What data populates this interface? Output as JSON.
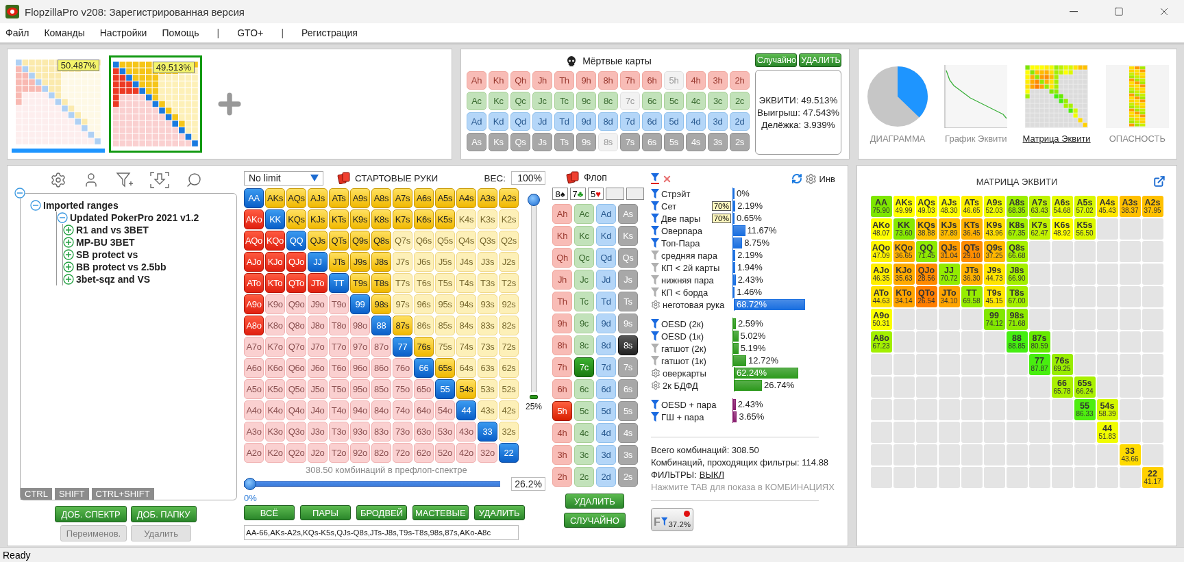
{
  "window": {
    "title": "FlopzillaPro v208: Зарегистрированная версия"
  },
  "menu": [
    {
      "kind": "item",
      "label": "Файл"
    },
    {
      "kind": "item",
      "label": "Команды"
    },
    {
      "kind": "item",
      "label": "Настройки"
    },
    {
      "kind": "item",
      "label": "Помощь"
    },
    {
      "kind": "separator",
      "label": "|"
    },
    {
      "kind": "item",
      "label": "GTO+"
    },
    {
      "kind": "separator",
      "label": "|"
    },
    {
      "kind": "item",
      "label": "Регистрация"
    }
  ],
  "ranges_bar": {
    "ranges": [
      {
        "percent": "50.487%",
        "selected": false
      },
      {
        "percent": "49.513%",
        "selected": true
      }
    ]
  },
  "dead_cards": {
    "title": "Мёртвые карты",
    "buttons": [
      "Случайно",
      "УДАЛИТЬ"
    ],
    "rows": [
      [
        {
          "label": "Ah",
          "disabled": false
        },
        {
          "label": "Kh",
          "disabled": false
        },
        {
          "label": "Qh",
          "disabled": false
        },
        {
          "label": "Jh",
          "disabled": false
        },
        {
          "label": "Th",
          "disabled": false
        },
        {
          "label": "9h",
          "disabled": false
        },
        {
          "label": "8h",
          "disabled": false
        },
        {
          "label": "7h",
          "disabled": false
        },
        {
          "label": "6h",
          "disabled": false
        },
        {
          "label": "5h",
          "disabled": true
        },
        {
          "label": "4h",
          "disabled": false
        },
        {
          "label": "3h",
          "disabled": false
        },
        {
          "label": "2h",
          "disabled": false
        }
      ],
      [
        {
          "label": "Ac",
          "disabled": false
        },
        {
          "label": "Kc",
          "disabled": false
        },
        {
          "label": "Qc",
          "disabled": false
        },
        {
          "label": "Jc",
          "disabled": false
        },
        {
          "label": "Tc",
          "disabled": false
        },
        {
          "label": "9c",
          "disabled": false
        },
        {
          "label": "8c",
          "disabled": false
        },
        {
          "label": "7c",
          "disabled": true
        },
        {
          "label": "6c",
          "disabled": false
        },
        {
          "label": "5c",
          "disabled": false
        },
        {
          "label": "4c",
          "disabled": false
        },
        {
          "label": "3c",
          "disabled": false
        },
        {
          "label": "2c",
          "disabled": false
        }
      ],
      [
        {
          "label": "Ad",
          "disabled": false
        },
        {
          "label": "Kd",
          "disabled": false
        },
        {
          "label": "Qd",
          "disabled": false
        },
        {
          "label": "Jd",
          "disabled": false
        },
        {
          "label": "Td",
          "disabled": false
        },
        {
          "label": "9d",
          "disabled": false
        },
        {
          "label": "8d",
          "disabled": false
        },
        {
          "label": "7d",
          "disabled": false
        },
        {
          "label": "6d",
          "disabled": false
        },
        {
          "label": "5d",
          "disabled": false
        },
        {
          "label": "4d",
          "disabled": false
        },
        {
          "label": "3d",
          "disabled": false
        },
        {
          "label": "2d",
          "disabled": false
        }
      ],
      [
        {
          "label": "As",
          "disabled": false
        },
        {
          "label": "Ks",
          "disabled": false
        },
        {
          "label": "Qs",
          "disabled": false
        },
        {
          "label": "Js",
          "disabled": false
        },
        {
          "label": "Ts",
          "disabled": false
        },
        {
          "label": "9s",
          "disabled": false
        },
        {
          "label": "8s",
          "disabled": true
        },
        {
          "label": "7s",
          "disabled": false
        },
        {
          "label": "6s",
          "disabled": false
        },
        {
          "label": "5s",
          "disabled": false
        },
        {
          "label": "4s",
          "disabled": false
        },
        {
          "label": "3s",
          "disabled": false
        },
        {
          "label": "2s",
          "disabled": false
        }
      ]
    ]
  },
  "equity": {
    "lines": [
      "ЭКВИТИ: 49.513%",
      "Выигрыш: 47.543%",
      "Делёжка: 3.939%"
    ]
  },
  "views": [
    {
      "label": "ДИАГРАММА",
      "kind": "pie",
      "selected": false
    },
    {
      "label": "График Эквити",
      "kind": "line",
      "selected": false
    },
    {
      "label": "Матрица Эквити",
      "kind": "matrix",
      "selected": true
    },
    {
      "label": "ОПАСНОСТЬ",
      "kind": "danger",
      "selected": false
    }
  ],
  "tree": {
    "expanded": true,
    "children": [
      {
        "label": "Imported ranges",
        "expanded": true,
        "children": [
          {
            "label": "Updated PokerPro 2021 v1.2",
            "expanded": true,
            "children": [
              {
                "label": "R1 and vs 3BET",
                "expanded": false
              },
              {
                "label": "MP-BU 3BET",
                "expanded": false
              },
              {
                "label": "SB protect vs",
                "expanded": false
              },
              {
                "label": "BB protect vs 2.5bb",
                "expanded": false
              },
              {
                "label": "3bet-sqz and VS",
                "expanded": false
              }
            ]
          }
        ]
      }
    ]
  },
  "modifier_tabs": [
    "CTRL",
    "SHIFT",
    "CTRL+SHIFT"
  ],
  "tree_buttons": [
    {
      "label": "ДОБ. СПЕКТР",
      "disabled": false
    },
    {
      "label": "ДОБ. ПАПКУ",
      "disabled": false
    },
    {
      "label": "Переименов.",
      "disabled": true
    },
    {
      "label": "Удалить",
      "disabled": true
    }
  ],
  "range": {
    "game": "No limit",
    "title": "СТАРТОВЫЕ РУКИ",
    "weight_label": "ВЕС:",
    "weight": "100%",
    "weight_slider": {
      "level": 1
    },
    "threshold": "25%",
    "rows": [
      {
        "cells": [
          {
            "label": "AA",
            "selected": true
          },
          {
            "label": "AKs",
            "selected": true
          },
          {
            "label": "AQs",
            "selected": true
          },
          {
            "label": "AJs",
            "selected": true
          },
          {
            "label": "ATs",
            "selected": true
          },
          {
            "label": "A9s",
            "selected": true
          },
          {
            "label": "A8s",
            "selected": true
          },
          {
            "label": "A7s",
            "selected": true
          },
          {
            "label": "A6s",
            "selected": true
          },
          {
            "label": "A5s",
            "selected": true
          },
          {
            "label": "A4s",
            "selected": true
          },
          {
            "label": "A3s",
            "selected": true
          },
          {
            "label": "A2s",
            "selected": true
          }
        ]
      },
      {
        "cells": [
          {
            "label": "AKo",
            "selected": true
          },
          {
            "label": "KK",
            "selected": true
          },
          {
            "label": "KQs",
            "selected": true
          },
          {
            "label": "KJs",
            "selected": true
          },
          {
            "label": "KTs",
            "selected": true
          },
          {
            "label": "K9s",
            "selected": true
          },
          {
            "label": "K8s",
            "selected": true
          },
          {
            "label": "K7s",
            "selected": true
          },
          {
            "label": "K6s",
            "selected": true
          },
          {
            "label": "K5s",
            "selected": true
          },
          {
            "label": "K4s",
            "selected": false
          },
          {
            "label": "K3s",
            "selected": false
          },
          {
            "label": "K2s",
            "selected": false
          }
        ]
      },
      {
        "cells": [
          {
            "label": "AQo",
            "selected": true
          },
          {
            "label": "KQo",
            "selected": true
          },
          {
            "label": "QQ",
            "selected": true
          },
          {
            "label": "QJs",
            "selected": true
          },
          {
            "label": "QTs",
            "selected": true
          },
          {
            "label": "Q9s",
            "selected": true
          },
          {
            "label": "Q8s",
            "selected": true
          },
          {
            "label": "Q7s",
            "selected": false
          },
          {
            "label": "Q6s",
            "selected": false
          },
          {
            "label": "Q5s",
            "selected": false
          },
          {
            "label": "Q4s",
            "selected": false
          },
          {
            "label": "Q3s",
            "selected": false
          },
          {
            "label": "Q2s",
            "selected": false
          }
        ]
      },
      {
        "cells": [
          {
            "label": "AJo",
            "selected": true
          },
          {
            "label": "KJo",
            "selected": true
          },
          {
            "label": "QJo",
            "selected": true
          },
          {
            "label": "JJ",
            "selected": true
          },
          {
            "label": "JTs",
            "selected": true
          },
          {
            "label": "J9s",
            "selected": true
          },
          {
            "label": "J8s",
            "selected": true
          },
          {
            "label": "J7s",
            "selected": false
          },
          {
            "label": "J6s",
            "selected": false
          },
          {
            "label": "J5s",
            "selected": false
          },
          {
            "label": "J4s",
            "selected": false
          },
          {
            "label": "J3s",
            "selected": false
          },
          {
            "label": "J2s",
            "selected": false
          }
        ]
      },
      {
        "cells": [
          {
            "label": "ATo",
            "selected": true
          },
          {
            "label": "KTo",
            "selected": true
          },
          {
            "label": "QTo",
            "selected": true
          },
          {
            "label": "JTo",
            "selected": true
          },
          {
            "label": "TT",
            "selected": true
          },
          {
            "label": "T9s",
            "selected": true
          },
          {
            "label": "T8s",
            "selected": true
          },
          {
            "label": "T7s",
            "selected": false
          },
          {
            "label": "T6s",
            "selected": false
          },
          {
            "label": "T5s",
            "selected": false
          },
          {
            "label": "T4s",
            "selected": false
          },
          {
            "label": "T3s",
            "selected": false
          },
          {
            "label": "T2s",
            "selected": false
          }
        ]
      },
      {
        "cells": [
          {
            "label": "A9o",
            "selected": true
          },
          {
            "label": "K9o",
            "selected": false
          },
          {
            "label": "Q9o",
            "selected": false
          },
          {
            "label": "J9o",
            "selected": false
          },
          {
            "label": "T9o",
            "selected": false
          },
          {
            "label": "99",
            "selected": true
          },
          {
            "label": "98s",
            "selected": true
          },
          {
            "label": "97s",
            "selected": false
          },
          {
            "label": "96s",
            "selected": false
          },
          {
            "label": "95s",
            "selected": false
          },
          {
            "label": "94s",
            "selected": false
          },
          {
            "label": "93s",
            "selected": false
          },
          {
            "label": "92s",
            "selected": false
          }
        ]
      },
      {
        "cells": [
          {
            "label": "A8o",
            "selected": true
          },
          {
            "label": "K8o",
            "selected": false
          },
          {
            "label": "Q8o",
            "selected": false
          },
          {
            "label": "J8o",
            "selected": false
          },
          {
            "label": "T8o",
            "selected": false
          },
          {
            "label": "98o",
            "selected": false
          },
          {
            "label": "88",
            "selected": true
          },
          {
            "label": "87s",
            "selected": true
          },
          {
            "label": "86s",
            "selected": false
          },
          {
            "label": "85s",
            "selected": false
          },
          {
            "label": "84s",
            "selected": false
          },
          {
            "label": "83s",
            "selected": false
          },
          {
            "label": "82s",
            "selected": false
          }
        ]
      },
      {
        "cells": [
          {
            "label": "A7o",
            "selected": false
          },
          {
            "label": "K7o",
            "selected": false
          },
          {
            "label": "Q7o",
            "selected": false
          },
          {
            "label": "J7o",
            "selected": false
          },
          {
            "label": "T7o",
            "selected": false
          },
          {
            "label": "97o",
            "selected": false
          },
          {
            "label": "87o",
            "selected": false
          },
          {
            "label": "77",
            "selected": true
          },
          {
            "label": "76s",
            "selected": true
          },
          {
            "label": "75s",
            "selected": false
          },
          {
            "label": "74s",
            "selected": false
          },
          {
            "label": "73s",
            "selected": false
          },
          {
            "label": "72s",
            "selected": false
          }
        ]
      },
      {
        "cells": [
          {
            "label": "A6o",
            "selected": false
          },
          {
            "label": "K6o",
            "selected": false
          },
          {
            "label": "Q6o",
            "selected": false
          },
          {
            "label": "J6o",
            "selected": false
          },
          {
            "label": "T6o",
            "selected": false
          },
          {
            "label": "96o",
            "selected": false
          },
          {
            "label": "86o",
            "selected": false
          },
          {
            "label": "76o",
            "selected": false
          },
          {
            "label": "66",
            "selected": true
          },
          {
            "label": "65s",
            "selected": true
          },
          {
            "label": "64s",
            "selected": false
          },
          {
            "label": "63s",
            "selected": false
          },
          {
            "label": "62s",
            "selected": false
          }
        ]
      },
      {
        "cells": [
          {
            "label": "A5o",
            "selected": false
          },
          {
            "label": "K5o",
            "selected": false
          },
          {
            "label": "Q5o",
            "selected": false
          },
          {
            "label": "J5o",
            "selected": false
          },
          {
            "label": "T5o",
            "selected": false
          },
          {
            "label": "95o",
            "selected": false
          },
          {
            "label": "85o",
            "selected": false
          },
          {
            "label": "75o",
            "selected": false
          },
          {
            "label": "65o",
            "selected": false
          },
          {
            "label": "55",
            "selected": true
          },
          {
            "label": "54s",
            "selected": true
          },
          {
            "label": "53s",
            "selected": false
          },
          {
            "label": "52s",
            "selected": false
          }
        ]
      },
      {
        "cells": [
          {
            "label": "A4o",
            "selected": false
          },
          {
            "label": "K4o",
            "selected": false
          },
          {
            "label": "Q4o",
            "selected": false
          },
          {
            "label": "J4o",
            "selected": false
          },
          {
            "label": "T4o",
            "selected": false
          },
          {
            "label": "94o",
            "selected": false
          },
          {
            "label": "84o",
            "selected": false
          },
          {
            "label": "74o",
            "selected": false
          },
          {
            "label": "64o",
            "selected": false
          },
          {
            "label": "54o",
            "selected": false
          },
          {
            "label": "44",
            "selected": true
          },
          {
            "label": "43s",
            "selected": false
          },
          {
            "label": "42s",
            "selected": false
          }
        ]
      },
      {
        "cells": [
          {
            "label": "A3o",
            "selected": false
          },
          {
            "label": "K3o",
            "selected": false
          },
          {
            "label": "Q3o",
            "selected": false
          },
          {
            "label": "J3o",
            "selected": false
          },
          {
            "label": "T3o",
            "selected": false
          },
          {
            "label": "93o",
            "selected": false
          },
          {
            "label": "83o",
            "selected": false
          },
          {
            "label": "73o",
            "selected": false
          },
          {
            "label": "63o",
            "selected": false
          },
          {
            "label": "53o",
            "selected": false
          },
          {
            "label": "43o",
            "selected": false
          },
          {
            "label": "33",
            "selected": true
          },
          {
            "label": "32s",
            "selected": false
          }
        ]
      },
      {
        "cells": [
          {
            "label": "A2o",
            "selected": false
          },
          {
            "label": "K2o",
            "selected": false
          },
          {
            "label": "Q2o",
            "selected": false
          },
          {
            "label": "J2o",
            "selected": false
          },
          {
            "label": "T2o",
            "selected": false
          },
          {
            "label": "92o",
            "selected": false
          },
          {
            "label": "82o",
            "selected": false
          },
          {
            "label": "72o",
            "selected": false
          },
          {
            "label": "62o",
            "selected": false
          },
          {
            "label": "52o",
            "selected": false
          },
          {
            "label": "42o",
            "selected": false
          },
          {
            "label": "32o",
            "selected": false
          },
          {
            "label": "22",
            "selected": true
          }
        ]
      }
    ],
    "combos_caption": "308.50 комбинаций в префлоп-спектре",
    "percent_slider": {
      "level": 0
    },
    "percent_min": "0%",
    "percent": "26.2%",
    "buttons": [
      "ВСЁ",
      "ПАРЫ",
      "БРОДВЕЙ",
      "МАСТЕВЫЕ",
      "УДАЛИТЬ"
    ],
    "text": "AA-66,AKs-A2s,KQs-K5s,QJs-Q8s,JTs-J8s,T9s-T8s,98s,87s,AKo-A8c"
  },
  "flop": {
    "title": "Флоп",
    "slots": [
      {
        "kind": "card",
        "rank": "8",
        "suit": "♠",
        "color": "#111111"
      },
      {
        "kind": "card",
        "rank": "7",
        "suit": "♣",
        "color": "#1f9a1f"
      },
      {
        "kind": "card",
        "rank": "5",
        "suit": "♥",
        "color": "#e01010"
      },
      {
        "kind": "empty"
      },
      {
        "kind": "empty"
      }
    ],
    "rows": [
      [
        {
          "label": "Ah",
          "selected": false
        },
        {
          "label": "Ac",
          "selected": false
        },
        {
          "label": "Ad",
          "selected": false
        },
        {
          "label": "As",
          "selected": false
        }
      ],
      [
        {
          "label": "Kh",
          "selected": false
        },
        {
          "label": "Kc",
          "selected": false
        },
        {
          "label": "Kd",
          "selected": false
        },
        {
          "label": "Ks",
          "selected": false
        }
      ],
      [
        {
          "label": "Qh",
          "selected": false
        },
        {
          "label": "Qc",
          "selected": false
        },
        {
          "label": "Qd",
          "selected": false
        },
        {
          "label": "Qs",
          "selected": false
        }
      ],
      [
        {
          "label": "Jh",
          "selected": false
        },
        {
          "label": "Jc",
          "selected": false
        },
        {
          "label": "Jd",
          "selected": false
        },
        {
          "label": "Js",
          "selected": false
        }
      ],
      [
        {
          "label": "Th",
          "selected": false
        },
        {
          "label": "Tc",
          "selected": false
        },
        {
          "label": "Td",
          "selected": false
        },
        {
          "label": "Ts",
          "selected": false
        }
      ],
      [
        {
          "label": "9h",
          "selected": false
        },
        {
          "label": "9c",
          "selected": false
        },
        {
          "label": "9d",
          "selected": false
        },
        {
          "label": "9s",
          "selected": false
        }
      ],
      [
        {
          "label": "8h",
          "selected": false
        },
        {
          "label": "8c",
          "selected": false
        },
        {
          "label": "8d",
          "selected": false
        },
        {
          "label": "8s",
          "selected": true
        }
      ],
      [
        {
          "label": "7h",
          "selected": false
        },
        {
          "label": "7c",
          "selected": true
        },
        {
          "label": "7d",
          "selected": false
        },
        {
          "label": "7s",
          "selected": false
        }
      ],
      [
        {
          "label": "6h",
          "selected": false
        },
        {
          "label": "6c",
          "selected": false
        },
        {
          "label": "6d",
          "selected": false
        },
        {
          "label": "6s",
          "selected": false
        }
      ],
      [
        {
          "label": "5h",
          "selected": true
        },
        {
          "label": "5c",
          "selected": false
        },
        {
          "label": "5d",
          "selected": false
        },
        {
          "label": "5s",
          "selected": false
        }
      ],
      [
        {
          "label": "4h",
          "selected": false
        },
        {
          "label": "4c",
          "selected": false
        },
        {
          "label": "4d",
          "selected": false
        },
        {
          "label": "4s",
          "selected": false
        }
      ],
      [
        {
          "label": "3h",
          "selected": false
        },
        {
          "label": "3c",
          "selected": false
        },
        {
          "label": "3d",
          "selected": false
        },
        {
          "label": "3s",
          "selected": false
        }
      ],
      [
        {
          "label": "2h",
          "selected": false
        },
        {
          "label": "2c",
          "selected": false
        },
        {
          "label": "2d",
          "selected": false
        },
        {
          "label": "2s",
          "selected": false
        }
      ]
    ],
    "buttons": [
      "УДАЛИТЬ",
      "СЛУЧАЙНО"
    ]
  },
  "stats": {
    "invert_label": "Инв",
    "groups": [
      {
        "color": "#1a6fe0",
        "items": [
          {
            "kind": "filter-on",
            "label": "Стрэйт",
            "value": "0%",
            "level": 0
          },
          {
            "kind": "filter-on",
            "label": "Сет",
            "badge": "70%",
            "value": "2.19%",
            "level": 0.0219
          },
          {
            "kind": "filter-on",
            "label": "Две пары",
            "badge": "70%",
            "value": "0.65%",
            "level": 0.0065
          },
          {
            "kind": "filter-on",
            "label": "Оверпара",
            "value": "11.67%",
            "level": 0.1167
          },
          {
            "kind": "filter-on",
            "label": "Топ-Пара",
            "value": "8.75%",
            "level": 0.0875
          },
          {
            "kind": "filter-off",
            "label": "средняя пара",
            "value": "2.19%",
            "level": 0.0219
          },
          {
            "kind": "filter-off",
            "label": "КП < 2й карты",
            "value": "1.94%",
            "level": 0.0194
          },
          {
            "kind": "filter-off",
            "label": "нижняя пара",
            "value": "2.43%",
            "level": 0.0243
          },
          {
            "kind": "filter-off",
            "label": "КП < борда",
            "value": "1.46%",
            "level": 0.0146
          },
          {
            "kind": "gear",
            "label": "неготовая рука",
            "value": "68.72%",
            "level": 0.6872
          }
        ]
      },
      {
        "color": "#2e9a1e",
        "items": [
          {
            "kind": "filter-on",
            "label": "OESD (2к)",
            "value": "2.59%",
            "level": 0.0259
          },
          {
            "kind": "filter-on",
            "label": "OESD (1к)",
            "value": "5.02%",
            "level": 0.0502
          },
          {
            "kind": "filter-off",
            "label": "гатшот (2к)",
            "value": "5.19%",
            "level": 0.0519
          },
          {
            "kind": "filter-off",
            "label": "гатшот (1к)",
            "value": "12.72%",
            "level": 0.1272
          },
          {
            "kind": "gear",
            "label": "оверкарты",
            "value": "62.24%",
            "level": 0.6224
          },
          {
            "kind": "gear",
            "label": "2к БДФД",
            "value": "26.74%",
            "level": 0.2674
          }
        ]
      },
      {
        "color": "#8a2070",
        "items": [
          {
            "kind": "filter-on",
            "label": "OESD + пара",
            "value": "2.43%",
            "level": 0.0243
          },
          {
            "kind": "filter-on",
            "label": "ГШ + пара",
            "value": "3.65%",
            "level": 0.0365
          }
        ]
      }
    ],
    "totals": [
      "Всего комбинаций: 308.50",
      "Комбинаций, проходящих фильтры: 114.88"
    ],
    "filters_label": "ФИЛЬТРЫ:",
    "filters_state": "ВЫКЛ",
    "hint": "Нажмите TAB для показа в КОМБИНАЦИЯХ",
    "filter_button": {
      "letter": "F",
      "value": "37.2%"
    }
  },
  "equity_matrix": {
    "title": "МАТРИЦА ЭКВИТИ",
    "rows": [
      [
        {
          "label": "AA",
          "value": "75.90",
          "color": "#7ee600"
        },
        {
          "label": "AKs",
          "value": "49.99",
          "color": "#ffff00"
        },
        {
          "label": "AQs",
          "value": "49.03",
          "color": "#ffff00"
        },
        {
          "label": "AJs",
          "value": "48.30",
          "color": "#ffff00"
        },
        {
          "label": "ATs",
          "value": "46.65",
          "color": "#fff000"
        },
        {
          "label": "A9s",
          "value": "52.03",
          "color": "#eefc00"
        },
        {
          "label": "A8s",
          "value": "68.35",
          "color": "#9cee00"
        },
        {
          "label": "A7s",
          "value": "63.43",
          "color": "#bdf200"
        },
        {
          "label": "A6s",
          "value": "54.68",
          "color": "#e4fa00"
        },
        {
          "label": "A5s",
          "value": "57.02",
          "color": "#d8f800"
        },
        {
          "label": "A4s",
          "value": "45.43",
          "color": "#ffe600"
        },
        {
          "label": "A3s",
          "value": "38.37",
          "color": "#ffbf00"
        },
        {
          "label": "A2s",
          "value": "37.95",
          "color": "#ffc000"
        }
      ],
      [
        {
          "label": "AKo",
          "value": "48.07",
          "color": "#ffff00"
        },
        {
          "label": "KK",
          "value": "73.60",
          "color": "#86e800"
        },
        {
          "label": "KQs",
          "value": "38.88",
          "color": "#ffc200"
        },
        {
          "label": "KJs",
          "value": "37.89",
          "color": "#ffbc00"
        },
        {
          "label": "KTs",
          "value": "36.45",
          "color": "#ffb000"
        },
        {
          "label": "K9s",
          "value": "43.96",
          "color": "#ffdd00"
        },
        {
          "label": "K8s",
          "value": "67.35",
          "color": "#a2ef00"
        },
        {
          "label": "K7s",
          "value": "62.47",
          "color": "#c2f300"
        },
        {
          "label": "K6s",
          "value": "48.92",
          "color": "#ffff00"
        },
        {
          "label": "K5s",
          "value": "56.50",
          "color": "#dcf800"
        },
        null,
        null,
        null
      ],
      [
        {
          "label": "AQo",
          "value": "47.09",
          "color": "#fff500"
        },
        {
          "label": "KQo",
          "value": "36.65",
          "color": "#ffb000"
        },
        {
          "label": "QQ",
          "value": "71.45",
          "color": "#8eea00"
        },
        {
          "label": "QJs",
          "value": "31.04",
          "color": "#ff9c00"
        },
        {
          "label": "QTs",
          "value": "29.10",
          "color": "#ff8c00"
        },
        {
          "label": "Q9s",
          "value": "37.25",
          "color": "#ffb800"
        },
        {
          "label": "Q8s",
          "value": "66.68",
          "color": "#a6ef00"
        },
        null,
        null,
        null,
        null,
        null,
        null
      ],
      [
        {
          "label": "AJo",
          "value": "46.35",
          "color": "#ffee00"
        },
        {
          "label": "KJo",
          "value": "35.63",
          "color": "#ffaa00"
        },
        {
          "label": "QJo",
          "value": "28.56",
          "color": "#ff8a00"
        },
        {
          "label": "JJ",
          "value": "70.72",
          "color": "#92eb00"
        },
        {
          "label": "JTs",
          "value": "36.30",
          "color": "#ffb000"
        },
        {
          "label": "J9s",
          "value": "44.73",
          "color": "#ffe400"
        },
        {
          "label": "J8s",
          "value": "66.90",
          "color": "#a4ef00"
        },
        null,
        null,
        null,
        null,
        null,
        null
      ],
      [
        {
          "label": "ATo",
          "value": "44.63",
          "color": "#ffe200"
        },
        {
          "label": "KTo",
          "value": "34.14",
          "color": "#ffa400"
        },
        {
          "label": "QTo",
          "value": "26.54",
          "color": "#ff7e00"
        },
        {
          "label": "JTo",
          "value": "34.10",
          "color": "#ffa400"
        },
        {
          "label": "TT",
          "value": "69.58",
          "color": "#96ec00"
        },
        {
          "label": "T9s",
          "value": "45.15",
          "color": "#ffe600"
        },
        {
          "label": "T8s",
          "value": "67.00",
          "color": "#a4ef00"
        },
        null,
        null,
        null,
        null,
        null,
        null
      ],
      [
        {
          "label": "A9o",
          "value": "50.31",
          "color": "#fafe00"
        },
        null,
        null,
        null,
        null,
        {
          "label": "99",
          "value": "74.12",
          "color": "#82e700"
        },
        {
          "label": "98s",
          "value": "71.68",
          "color": "#8eea00"
        },
        null,
        null,
        null,
        null,
        null,
        null
      ],
      [
        {
          "label": "A8o",
          "value": "67.23",
          "color": "#a2ef00"
        },
        null,
        null,
        null,
        null,
        null,
        {
          "label": "88",
          "value": "88.85",
          "color": "#44ee10"
        },
        {
          "label": "87s",
          "value": "80.59",
          "color": "#66ea00"
        },
        null,
        null,
        null,
        null,
        null
      ],
      [
        null,
        null,
        null,
        null,
        null,
        null,
        null,
        {
          "label": "77",
          "value": "87.87",
          "color": "#48ee10"
        },
        {
          "label": "76s",
          "value": "69.25",
          "color": "#98ec00"
        },
        null,
        null,
        null,
        null
      ],
      [
        null,
        null,
        null,
        null,
        null,
        null,
        null,
        null,
        {
          "label": "66",
          "value": "65.78",
          "color": "#aaf000"
        },
        {
          "label": "65s",
          "value": "66.24",
          "color": "#a8f000"
        },
        null,
        null,
        null
      ],
      [
        null,
        null,
        null,
        null,
        null,
        null,
        null,
        null,
        null,
        {
          "label": "55",
          "value": "86.33",
          "color": "#4eee10"
        },
        {
          "label": "54s",
          "value": "58.39",
          "color": "#d2f700"
        },
        null,
        null
      ],
      [
        null,
        null,
        null,
        null,
        null,
        null,
        null,
        null,
        null,
        null,
        {
          "label": "44",
          "value": "51.83",
          "color": "#f0fc00"
        },
        null,
        null
      ],
      [
        null,
        null,
        null,
        null,
        null,
        null,
        null,
        null,
        null,
        null,
        null,
        {
          "label": "33",
          "value": "43.66",
          "color": "#ffda00"
        },
        null
      ],
      [
        null,
        null,
        null,
        null,
        null,
        null,
        null,
        null,
        null,
        null,
        null,
        null,
        {
          "label": "22",
          "value": "41.17",
          "color": "#ffd000"
        }
      ]
    ]
  },
  "status_bar": "Ready"
}
